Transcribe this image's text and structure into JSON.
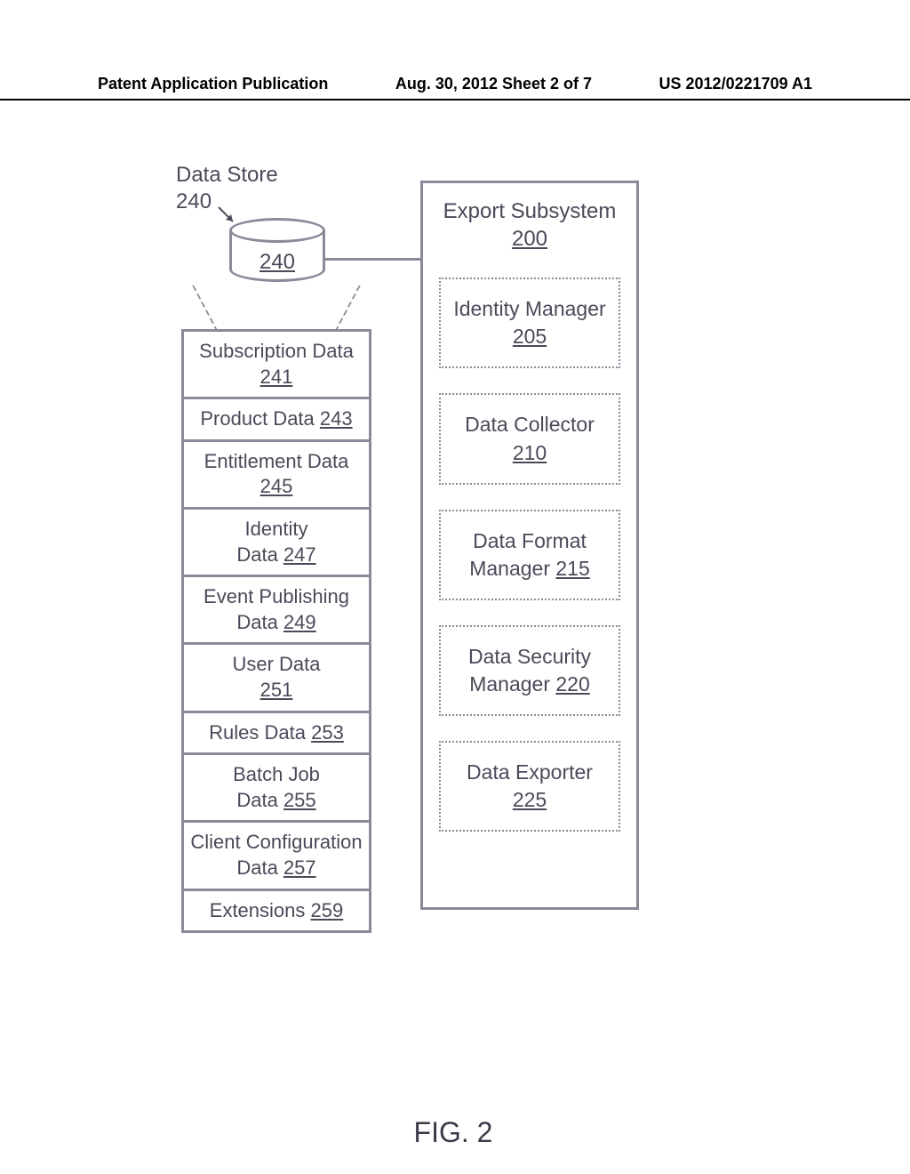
{
  "header": {
    "left": "Patent Application Publication",
    "center": "Aug. 30, 2012  Sheet 2 of 7",
    "right": "US 2012/0221709 A1"
  },
  "datastore": {
    "label": "Data Store",
    "ref": "240",
    "cyl_ref": "240",
    "items": [
      {
        "label": "Subscription Data",
        "ref": "241"
      },
      {
        "label": "Product Data",
        "ref": "243"
      },
      {
        "label": "Entitlement Data",
        "ref": "245"
      },
      {
        "label": "Identity Data",
        "ref": "247"
      },
      {
        "label": "Event Publishing Data",
        "ref": "249"
      },
      {
        "label": "User Data",
        "ref": "251"
      },
      {
        "label": "Rules Data",
        "ref": "253"
      },
      {
        "label": "Batch Job Data",
        "ref": "255"
      },
      {
        "label": "Client Configuration Data",
        "ref": "257"
      },
      {
        "label": "Extensions",
        "ref": "259"
      }
    ]
  },
  "subsystem": {
    "title": "Export Subsystem",
    "ref": "200",
    "boxes": [
      {
        "label": "Identity Manager",
        "ref": "205"
      },
      {
        "label": "Data Collector",
        "ref": "210"
      },
      {
        "label": "Data Format Manager",
        "ref": "215"
      },
      {
        "label": "Data Security Manager",
        "ref": "220"
      },
      {
        "label": "Data Exporter",
        "ref": "225"
      }
    ]
  },
  "figure": "FIG. 2"
}
